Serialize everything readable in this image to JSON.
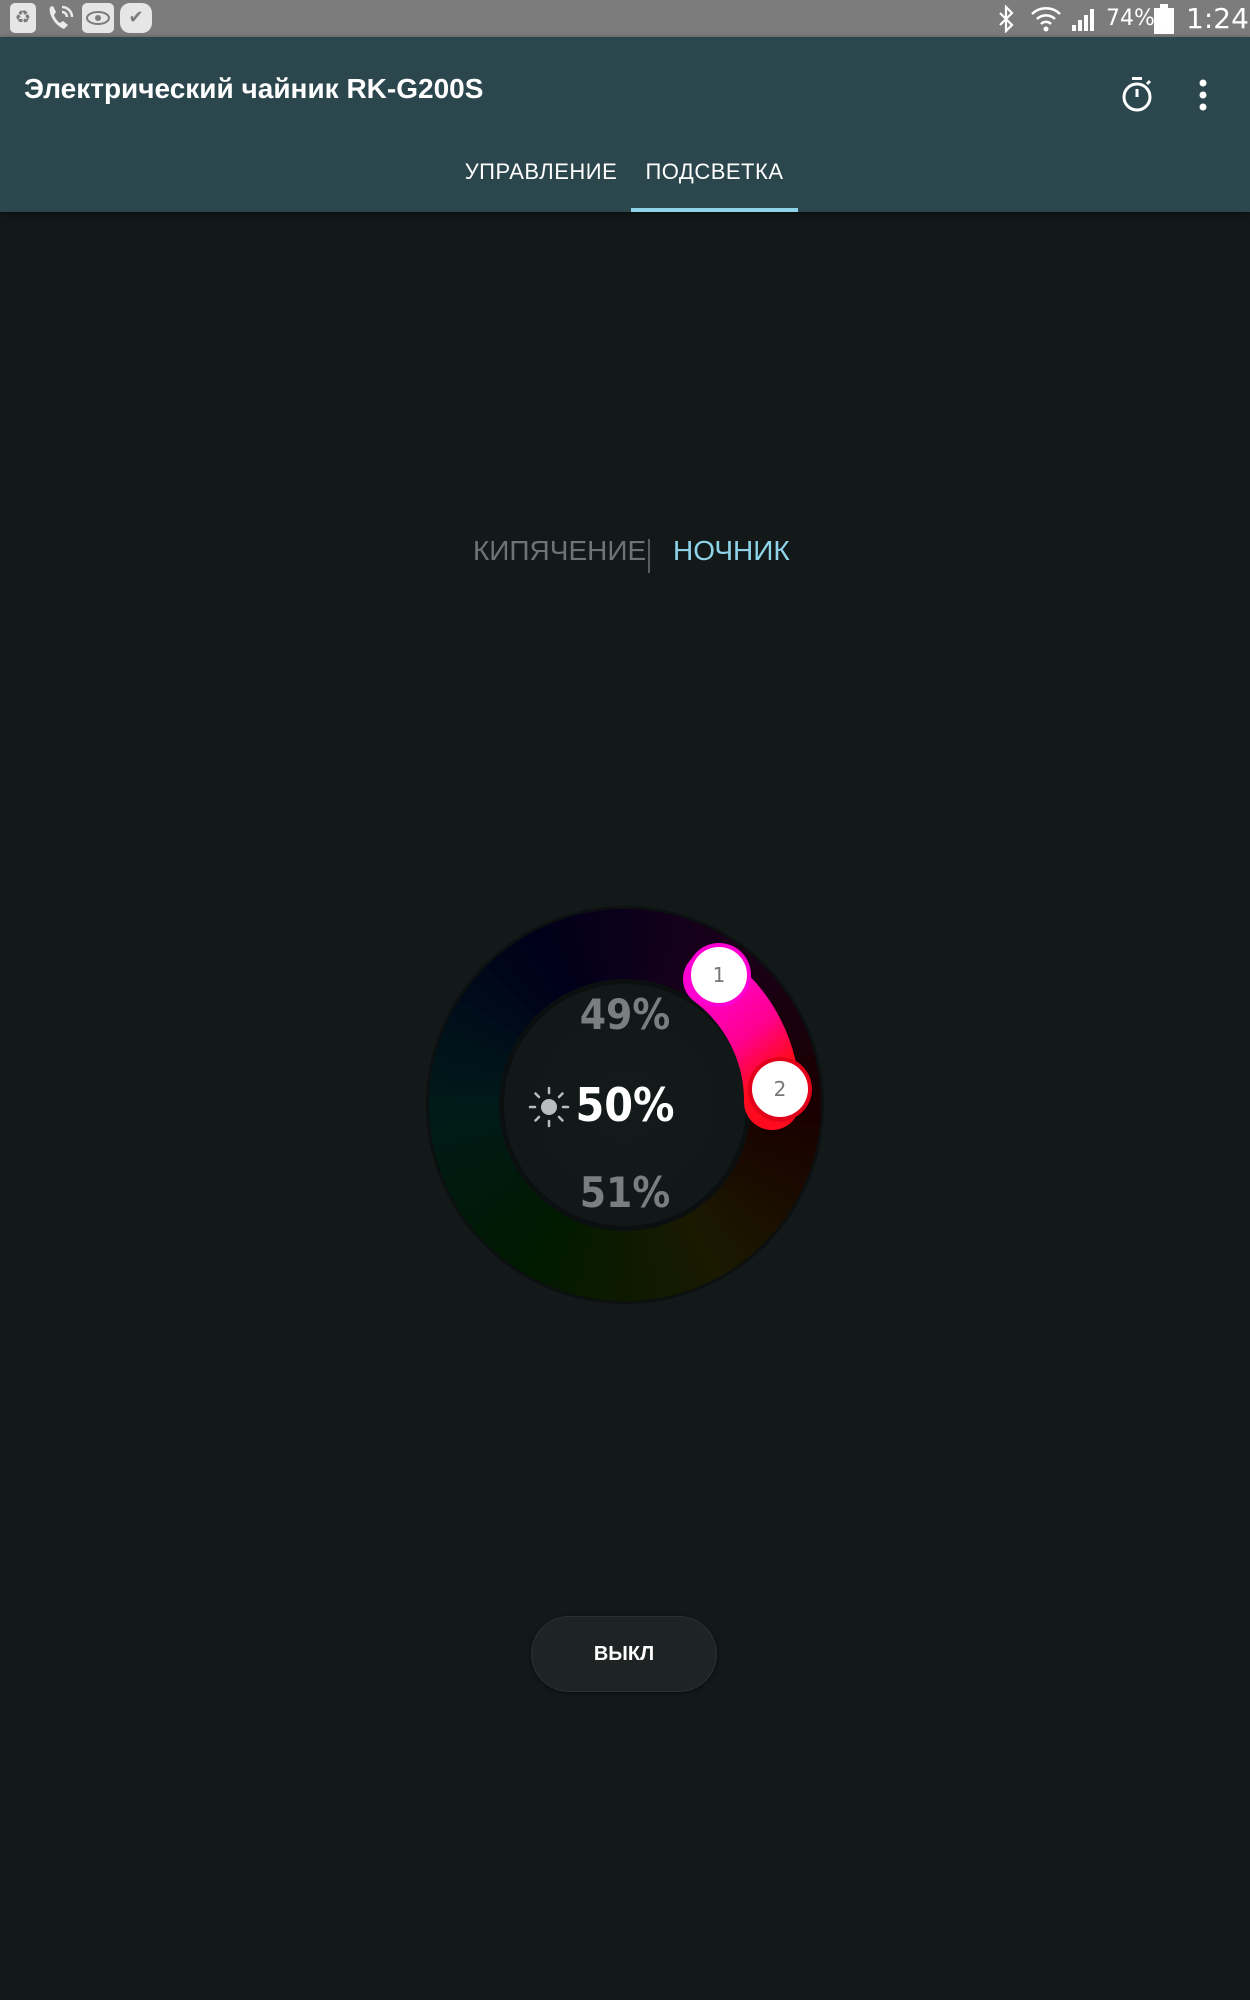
{
  "status_bar": {
    "battery_percent": "74%",
    "time": "1:24",
    "left_icons": [
      "recycle-icon",
      "phone-call-icon",
      "eye-icon",
      "check-icon"
    ],
    "right_icons": [
      "bluetooth-icon",
      "wifi-icon",
      "signal-icon",
      "battery-icon"
    ]
  },
  "app_bar": {
    "title": "Электрический чайник RK-G200S",
    "actions": [
      "timer-icon",
      "more-vert-icon"
    ]
  },
  "tabs": [
    {
      "label": "УПРАВЛЕНИЕ",
      "active": false
    },
    {
      "label": "ПОДСВЕТКА",
      "active": true
    }
  ],
  "mode_switch": {
    "options": [
      "КИПЯЧЕНИЕ",
      "НОЧНИК"
    ],
    "selected": "НОЧНИК"
  },
  "color_wheel": {
    "handle_1": "1",
    "handle_2": "2",
    "brightness_upper": "49%",
    "brightness_current": "50%",
    "brightness_lower": "51%",
    "brightness_icon": "sun-icon",
    "handle_1_color": "#ff00d2",
    "handle_2_color": "#ff0a1e"
  },
  "off_button": {
    "label": "ВЫКЛ"
  },
  "colors": {
    "app_bar": "#2c464d",
    "background": "#131919",
    "accent": "#8fd3e8",
    "inactive_mode": "#6e7373"
  }
}
